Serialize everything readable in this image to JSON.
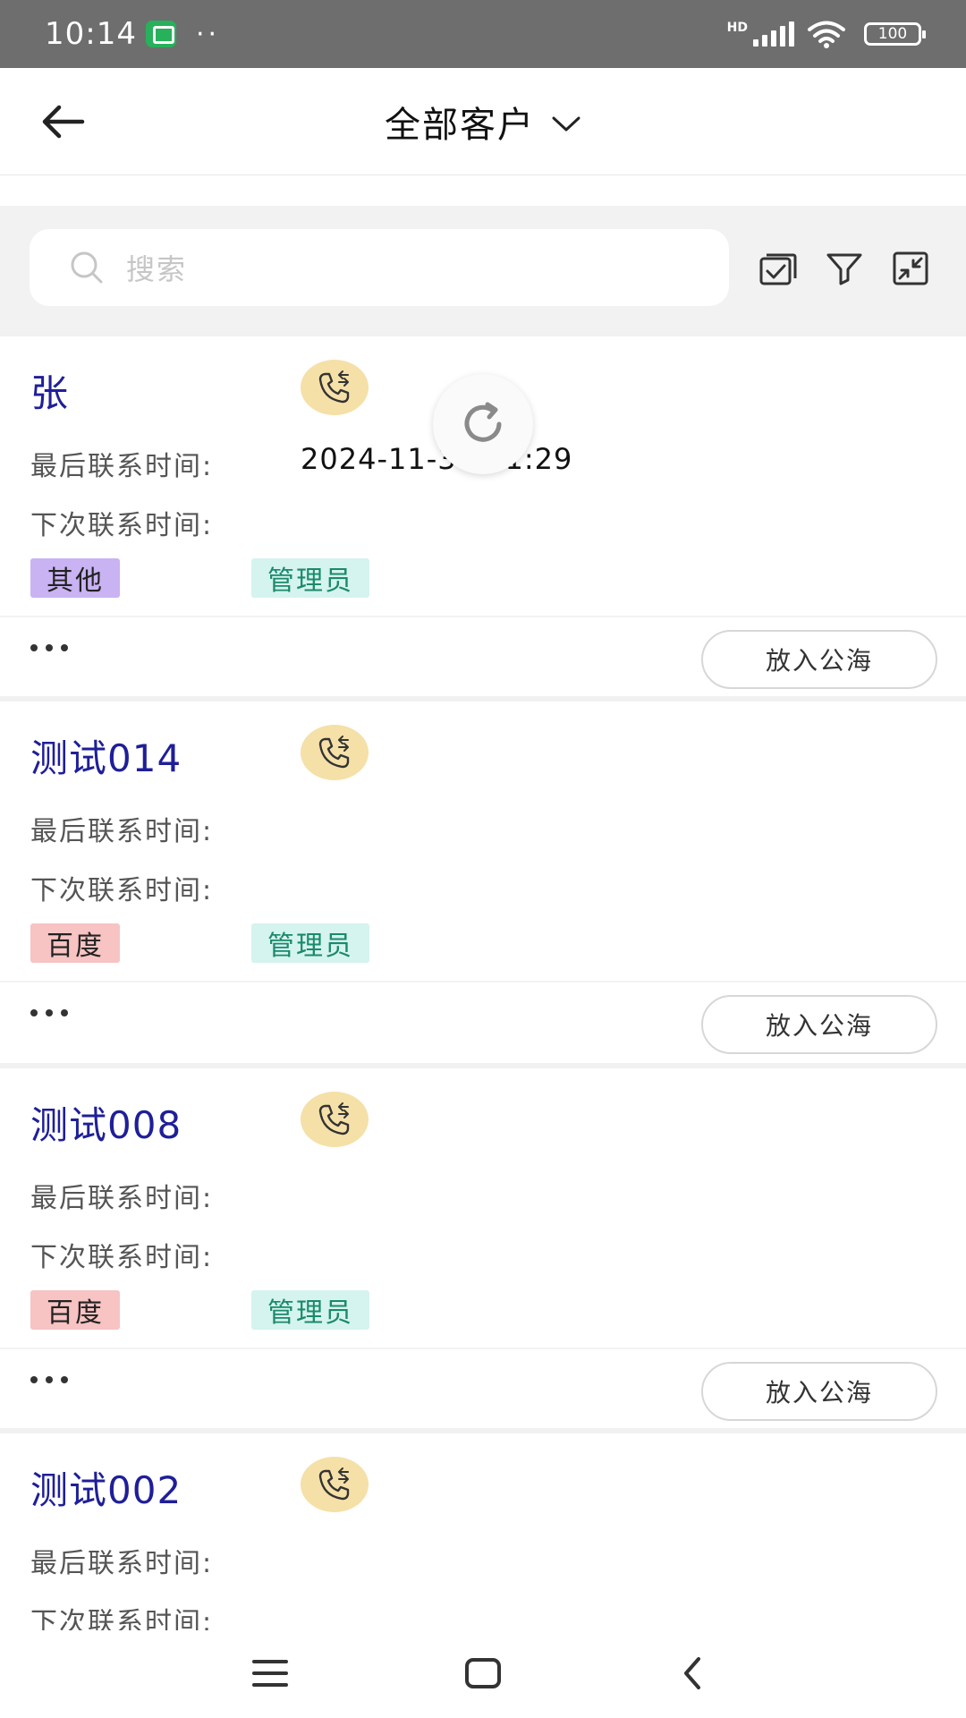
{
  "status_bar": {
    "time": "10:14",
    "dots": "··",
    "network": "HD",
    "battery": "100"
  },
  "header": {
    "title": "全部客户"
  },
  "search": {
    "placeholder": "搜索"
  },
  "toolbar": {
    "icons": [
      "batch-select-icon",
      "filter-icon",
      "collapse-icon"
    ]
  },
  "field_labels": {
    "last_contact": "最后联系时间:",
    "next_contact": "下次联系时间:"
  },
  "customers": [
    {
      "name": "张",
      "last_contact": "2024-11-30 11:29",
      "next_contact": "",
      "source_tag": "其他",
      "role_tag": "管理员",
      "action": "放入公海"
    },
    {
      "name": "测试014",
      "last_contact": "",
      "next_contact": "",
      "source_tag": "百度",
      "role_tag": "管理员",
      "action": "放入公海"
    },
    {
      "name": "测试008",
      "last_contact": "",
      "next_contact": "",
      "source_tag": "百度",
      "role_tag": "管理员",
      "action": "放入公海"
    },
    {
      "name": "测试002",
      "last_contact": "",
      "next_contact": ""
    }
  ],
  "colors": {
    "name": "#1f1f99",
    "call_bg": "#f5e0a8",
    "tag_other": "#c9b3f3",
    "tag_baidu": "#f7c3c3",
    "tag_admin": "#d5f3ef"
  }
}
